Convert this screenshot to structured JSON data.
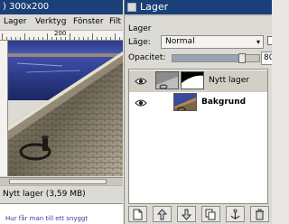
{
  "image_window": {
    "title": ") 300x200",
    "menu": [
      "Lager",
      "Verktyg",
      "Fönster",
      "Filt"
    ],
    "ruler_label": "200",
    "status": "Nytt lager (3,59 MB)",
    "below_text": "Hur får man till ett snyggt"
  },
  "layers_dialog": {
    "title": "Lager",
    "section_label": "Lager",
    "mode_label": "Läge:",
    "mode_value": "Normal",
    "opacity_label": "Opacitet:",
    "opacity_value": "80",
    "opacity_fraction": 0.8,
    "layers": [
      {
        "name": "Nytt lager",
        "visible": true,
        "selected": true,
        "bold": false
      },
      {
        "name": "Bakgrund",
        "visible": true,
        "selected": false,
        "bold": true
      }
    ],
    "toolbar_icons": [
      "new-layer-icon",
      "raise-layer-icon",
      "lower-layer-icon",
      "duplicate-layer-icon",
      "anchor-layer-icon",
      "delete-layer-icon"
    ]
  },
  "colors": {
    "titlebar": "#1b3f78",
    "selection": "#d2cec6",
    "window_bg": "#dcdad5"
  }
}
